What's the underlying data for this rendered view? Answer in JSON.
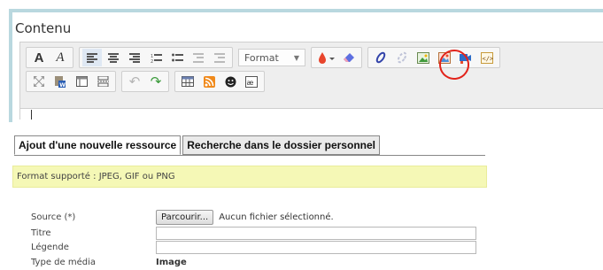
{
  "editor": {
    "title": "Contenu",
    "format_label": "Format"
  },
  "tabs": [
    {
      "label": "Ajout d'une nouvelle ressource",
      "active": true
    },
    {
      "label": "Recherche dans le dossier personnel",
      "active": false
    }
  ],
  "notice": "Format supporté : JPEG, GIF ou PNG",
  "form": {
    "source_label": "Source (*)",
    "browse_button": "Parcourir...",
    "no_file_text": "Aucun fichier sélectionné.",
    "title_label": "Titre",
    "title_value": "",
    "caption_label": "Légende",
    "caption_value": "",
    "media_type_label": "Type de média",
    "media_type_value": "Image"
  },
  "colors": {
    "notice_bg": "#f5f8b6",
    "highlight_circle": "#e2231a",
    "frame": "#b9d8df"
  }
}
